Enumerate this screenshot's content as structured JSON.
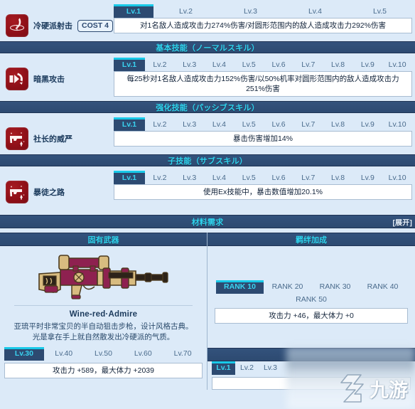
{
  "skills": [
    {
      "id": "ex-skill",
      "icon": "crescent-slash-icon",
      "name": "冷硬派射击",
      "cost": "COST 4",
      "levels": [
        "Lv.1",
        "Lv.2",
        "Lv.3",
        "Lv.4",
        "Lv.5"
      ],
      "active_level": "Lv.1",
      "description": "对1名敌人造成攻击力274%伤害/对圆形范围内的敌人造成攻击力292%伤害"
    },
    {
      "id": "normal-skill",
      "icon": "dark-burst-icon",
      "name": "暗黑攻击",
      "cost": "",
      "levels": [
        "Lv.1",
        "Lv.2",
        "Lv.3",
        "Lv.4",
        "Lv.5",
        "Lv.6",
        "Lv.7",
        "Lv.8",
        "Lv.9",
        "Lv.10"
      ],
      "active_level": "Lv.1",
      "description": "每25秒对1名敌人造成攻击力152%伤害/以50%机率对圆形范围内的敌人造成攻击力251%伤害"
    },
    {
      "id": "passive-skill",
      "icon": "pistol-up-icon",
      "name": "社长的威严",
      "cost": "",
      "levels": [
        "Lv.1",
        "Lv.2",
        "Lv.3",
        "Lv.4",
        "Lv.5",
        "Lv.6",
        "Lv.7",
        "Lv.8",
        "Lv.9",
        "Lv.10"
      ],
      "active_level": "Lv.1",
      "description": "暴击伤害增加14%"
    },
    {
      "id": "sub-skill",
      "icon": "pistol-up-icon",
      "name": "暴徒之路",
      "cost": "",
      "levels": [
        "Lv.1",
        "Lv.2",
        "Lv.3",
        "Lv.4",
        "Lv.5",
        "Lv.6",
        "Lv.7",
        "Lv.8",
        "Lv.9",
        "Lv.10"
      ],
      "active_level": "Lv.1",
      "description": "使用Ex技能中，暴击数值增加20.1%"
    }
  ],
  "sections": {
    "normal_skill_header": "基本技能（ノーマルスキル）",
    "passive_skill_header": "强化技能（パッシブスキル）",
    "sub_skill_header": "子技能（サブスキル）",
    "materials_header": "材料需求",
    "materials_expand": "[展开]"
  },
  "columns": {
    "weapon_header": "固有武器",
    "bond_header": "羁绊加成"
  },
  "weapon": {
    "art": "sniper-rifle-icon",
    "name": "Wine-red·Admire",
    "description_line1": "亚琉平时非常宝贝的半自动狙击步枪，设计风格古典。",
    "description_line2": "光是拿在手上就自然散发出冷硬派的气质。",
    "levels": [
      "Lv.30",
      "Lv.40",
      "Lv.50",
      "Lv.60",
      "Lv.70"
    ],
    "active_level": "Lv.30",
    "stats": "攻击力 +589，最大体力 +2039"
  },
  "bond": {
    "ranks": [
      "RANK 10",
      "RANK 20",
      "RANK 30",
      "RANK 40",
      "RANK 50"
    ],
    "active_rank": "RANK 10",
    "stats": "攻击力 +46，最大体力 +0"
  },
  "bond_extra": {
    "levels": [
      "Lv.1",
      "Lv.2",
      "Lv.3"
    ],
    "active_level": "Lv.1"
  },
  "watermark": {
    "text": "九游"
  },
  "colors": {
    "accent_cyan": "#2fd4ef",
    "header_navy": "#2d4a71",
    "page_bg": "#dceaf8",
    "icon_red": "#8d0f17"
  }
}
